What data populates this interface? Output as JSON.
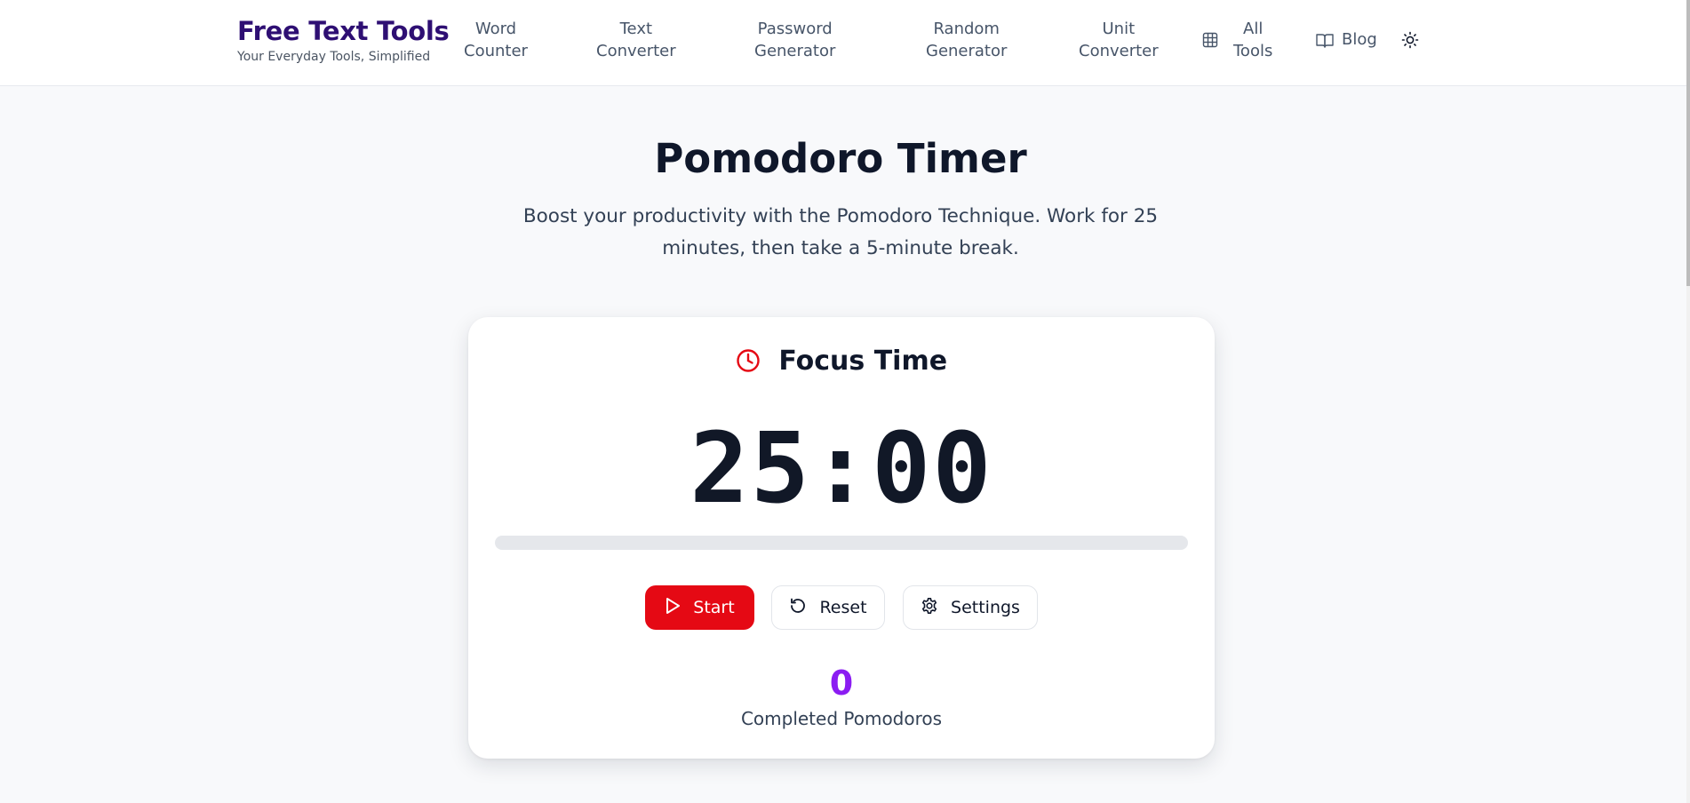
{
  "header": {
    "brand_title": "Free Text Tools",
    "brand_tagline": "Your Everyday Tools, Simplified",
    "nav": [
      {
        "line1": "Word",
        "line2": "Counter"
      },
      {
        "line1": "Text",
        "line2": "Converter"
      },
      {
        "line1": "Password",
        "line2": "Generator"
      },
      {
        "line1": "Random",
        "line2": "Generator"
      },
      {
        "line1": "Unit",
        "line2": "Converter"
      },
      {
        "line1": "All",
        "line2": "Tools",
        "icon": "grid-icon"
      }
    ],
    "blog": {
      "label": "Blog",
      "icon": "book-open-icon"
    },
    "theme_toggle_icon": "sun-icon"
  },
  "page": {
    "title": "Pomodoro Timer",
    "subtitle": "Boost your productivity with the Pomodoro Technique. Work for 25 minutes, then take a 5-minute break."
  },
  "timer": {
    "mode_label": "Focus Time",
    "mode_icon": "clock-icon",
    "time": "25:00",
    "progress": 0,
    "buttons": {
      "start": {
        "label": "Start",
        "icon": "play-icon"
      },
      "reset": {
        "label": "Reset",
        "icon": "rotate-ccw-icon"
      },
      "settings": {
        "label": "Settings",
        "icon": "gear-icon"
      }
    },
    "completed_count": "0",
    "completed_label": "Completed Pomodoros"
  },
  "colors": {
    "brand": "#2e0f73",
    "accent_red": "#e50914",
    "count_purple": "#8b1cf2"
  }
}
